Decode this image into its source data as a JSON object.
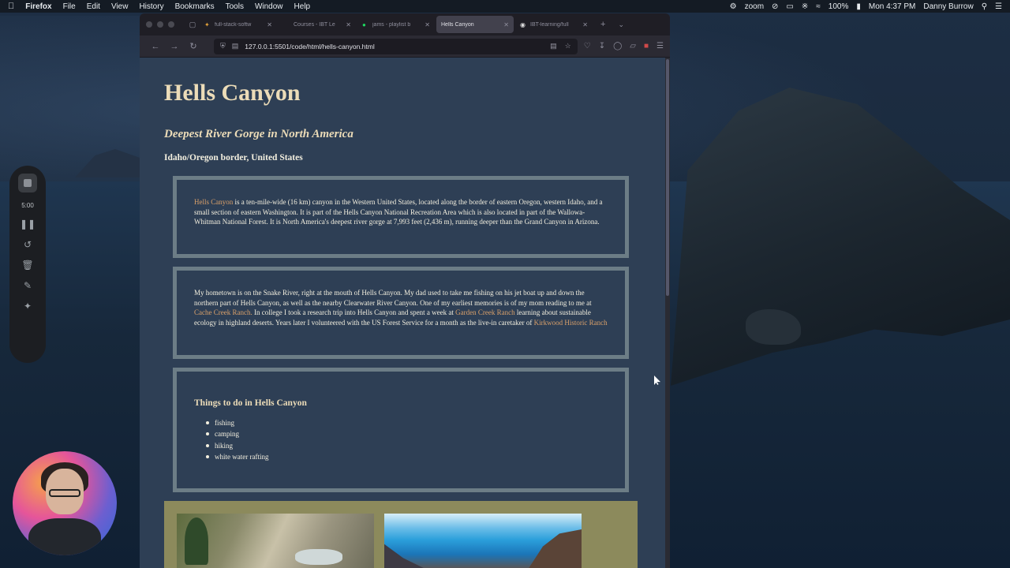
{
  "menubar": {
    "app_name": "Firefox",
    "menus": [
      "File",
      "Edit",
      "View",
      "History",
      "Bookmarks",
      "Tools",
      "Window",
      "Help"
    ],
    "zoom_label": "zoom",
    "battery": "100%",
    "datetime": "Mon 4:37 PM",
    "user": "Danny Burrow"
  },
  "recorder": {
    "time": "5:00"
  },
  "browser": {
    "tabs": [
      {
        "label": "full-stack-softw",
        "icon": "slack-icon",
        "active": false
      },
      {
        "label": "Courses - IBT Le",
        "icon": "page-icon",
        "active": false
      },
      {
        "label": "jams - playlist b",
        "icon": "spotify-icon",
        "active": false
      },
      {
        "label": "Hells Canyon",
        "icon": "none",
        "active": true
      },
      {
        "label": "IBT-learning/full",
        "icon": "github-icon",
        "active": false
      }
    ],
    "url": "127.0.0.1:5501/code/html/hells-canyon.html"
  },
  "page": {
    "title": "Hells Canyon",
    "subtitle": "Deepest River Gorge in North America",
    "location": "Idaho/Oregon border, United States",
    "intro": {
      "link": "Hells Canyon",
      "text": " is a ten-mile-wide (16 km) canyon in the Western United States, located along the border of eastern Oregon, western Idaho, and a small section of eastern Washington. It is part of the Hells Canyon National Recreation Area which is also located in part of the Wallowa-Whitman National Forest. It is North America's deepest river gorge at 7,993 feet (2,436 m), running deeper than the Grand Canyon in Arizona."
    },
    "story": {
      "text1": "My hometown is on the Snake River, right at the mouth of Hells Canyon. My dad used to take me fishing on his jet boat up and down the northern part of Hells Canyon, as well as the nearby Clearwater River Canyon. One of my earliest memories is of my mom reading to me at ",
      "link1": "Cache Creek Ranch.",
      "text2": " In college I took a research trip into Hells Canyon and spent a week at ",
      "link2": "Garden Creek Ranch",
      "text3": " learning about sustainable ecology in highland deserts. Years later I volunteered with the US Forest Service for a month as the live-in caretaker of ",
      "link3": "Kirkwood Historic Ranch"
    },
    "todo": {
      "heading": "Things to do in Hells Canyon",
      "items": [
        "fishing",
        "camping",
        "hiking",
        "white water rafting"
      ]
    }
  },
  "colors": {
    "page_bg": "#2e3f55",
    "heading": "#ecdcb8",
    "link": "#d9a06a",
    "box_border": "#6c7d86",
    "gallery_bg": "#8c8a5c"
  }
}
